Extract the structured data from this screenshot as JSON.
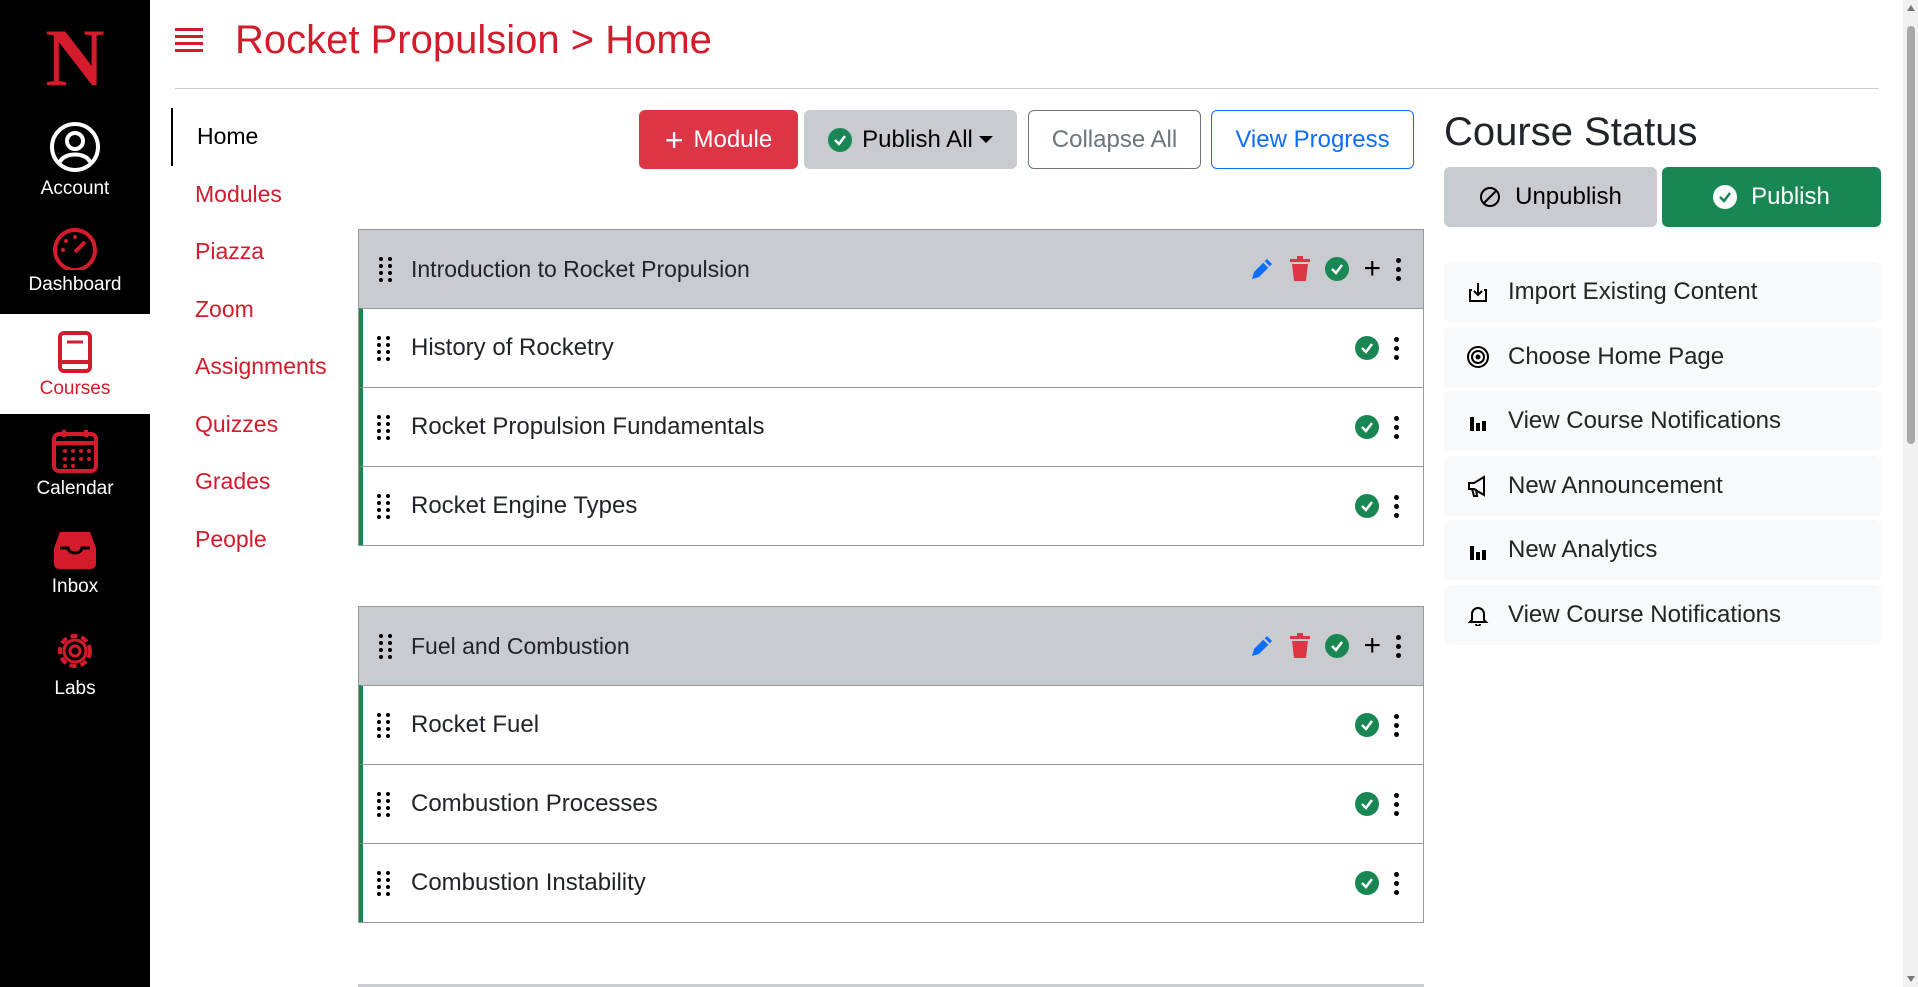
{
  "global_nav": {
    "logo": "N",
    "items": [
      {
        "label": "Account",
        "icon": "account-icon",
        "active": false
      },
      {
        "label": "Dashboard",
        "icon": "dashboard-icon",
        "active": false
      },
      {
        "label": "Courses",
        "icon": "book-icon",
        "active": true
      },
      {
        "label": "Calendar",
        "icon": "calendar-icon",
        "active": false
      },
      {
        "label": "Inbox",
        "icon": "inbox-icon",
        "active": false
      },
      {
        "label": "Labs",
        "icon": "gear-icon",
        "active": false
      }
    ]
  },
  "header": {
    "breadcrumb": "Rocket Propulsion > Home"
  },
  "course_nav": {
    "items": [
      "Home",
      "Modules",
      "Piazza",
      "Zoom",
      "Assignments",
      "Quizzes",
      "Grades",
      "People"
    ],
    "active": "Home"
  },
  "toolbar": {
    "module_label": "Module",
    "publish_all_label": "Publish All",
    "collapse_all_label": "Collapse All",
    "view_progress_label": "View Progress"
  },
  "modules": [
    {
      "title": "Introduction to Rocket Propulsion",
      "lessons": [
        "History of Rocketry",
        "Rocket Propulsion Fundamentals",
        "Rocket Engine Types"
      ]
    },
    {
      "title": "Fuel and Combustion",
      "lessons": [
        "Rocket Fuel",
        "Combustion Processes",
        "Combustion Instability"
      ]
    }
  ],
  "course_status": {
    "title": "Course Status",
    "unpublish_label": "Unpublish",
    "publish_label": "Publish",
    "actions": [
      {
        "label": "Import Existing Content",
        "icon": "import-icon"
      },
      {
        "label": "Choose Home Page",
        "icon": "target-icon"
      },
      {
        "label": "View Course Notifications",
        "icon": "bar-chart-icon"
      },
      {
        "label": "New Announcement",
        "icon": "megaphone-icon"
      },
      {
        "label": "New Analytics",
        "icon": "bar-chart-icon"
      },
      {
        "label": "View Course Notifications",
        "icon": "bell-icon"
      }
    ]
  },
  "colors": {
    "brand_red": "#d41b2c",
    "danger": "#dc3545",
    "success": "#198754",
    "primary": "#0d6efd",
    "secondary_bg": "#c8cbcf"
  }
}
